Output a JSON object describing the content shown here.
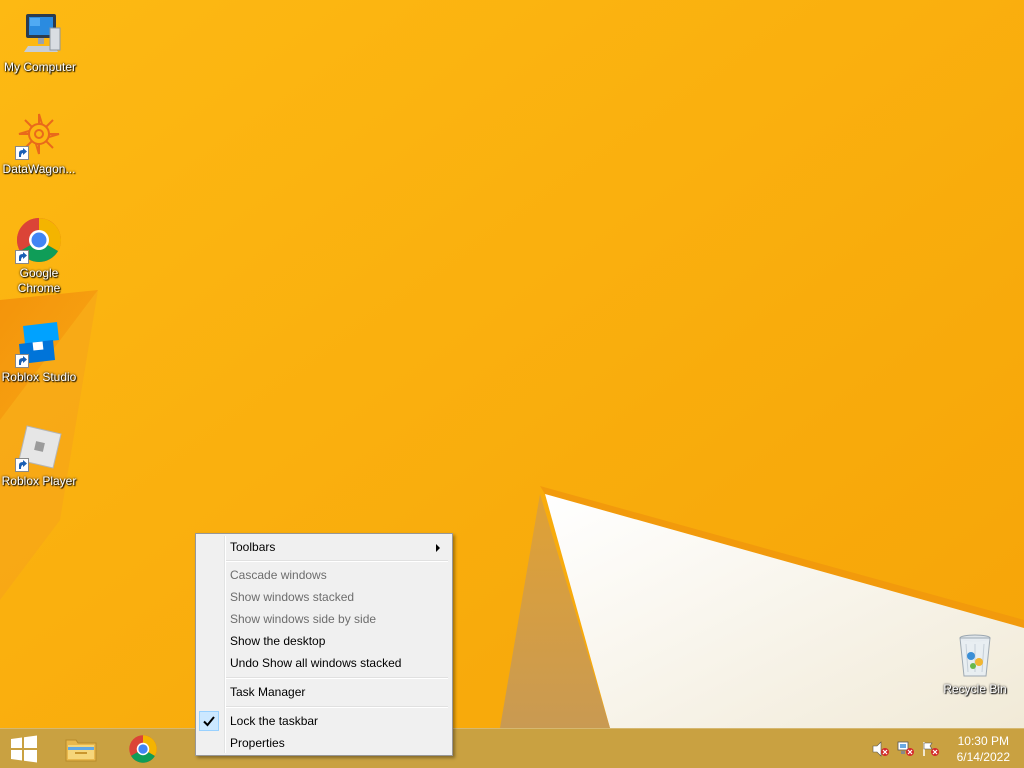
{
  "desktop": {
    "wallpaper_color": "#fcbc0a",
    "icons": [
      {
        "label": "My Computer",
        "icon": "computer-icon"
      },
      {
        "label": "DataWagon...",
        "icon": "datawagon-icon"
      },
      {
        "label": "Google Chrome",
        "icon": "chrome-icon"
      },
      {
        "label": "Roblox Studio",
        "icon": "roblox-studio-icon"
      },
      {
        "label": "Roblox Player",
        "icon": "roblox-player-icon"
      },
      {
        "label": "Recycle Bin",
        "icon": "recycle-bin-icon"
      }
    ]
  },
  "context_menu": {
    "items": [
      {
        "label": "Toolbars",
        "enabled": true,
        "submenu": true
      },
      {
        "label": "Cascade windows",
        "enabled": false
      },
      {
        "label": "Show windows stacked",
        "enabled": false
      },
      {
        "label": "Show windows side by side",
        "enabled": false
      },
      {
        "label": "Show the desktop",
        "enabled": true
      },
      {
        "label": "Undo Show all windows stacked",
        "enabled": true
      },
      {
        "label": "Task Manager",
        "enabled": true
      },
      {
        "label": "Lock the taskbar",
        "enabled": true,
        "checked": true
      },
      {
        "label": "Properties",
        "enabled": true
      }
    ]
  },
  "taskbar": {
    "start_icon": "windows-logo-icon",
    "pinned": [
      {
        "name": "file-explorer",
        "icon": "folder-icon"
      },
      {
        "name": "google-chrome",
        "icon": "chrome-icon"
      }
    ],
    "tray": [
      {
        "name": "volume-muted",
        "icon": "volume-muted-icon"
      },
      {
        "name": "network",
        "icon": "network-error-icon"
      },
      {
        "name": "action-center",
        "icon": "flag-error-icon"
      }
    ],
    "clock": {
      "time": "10:30 PM",
      "date": "6/14/2022"
    }
  }
}
